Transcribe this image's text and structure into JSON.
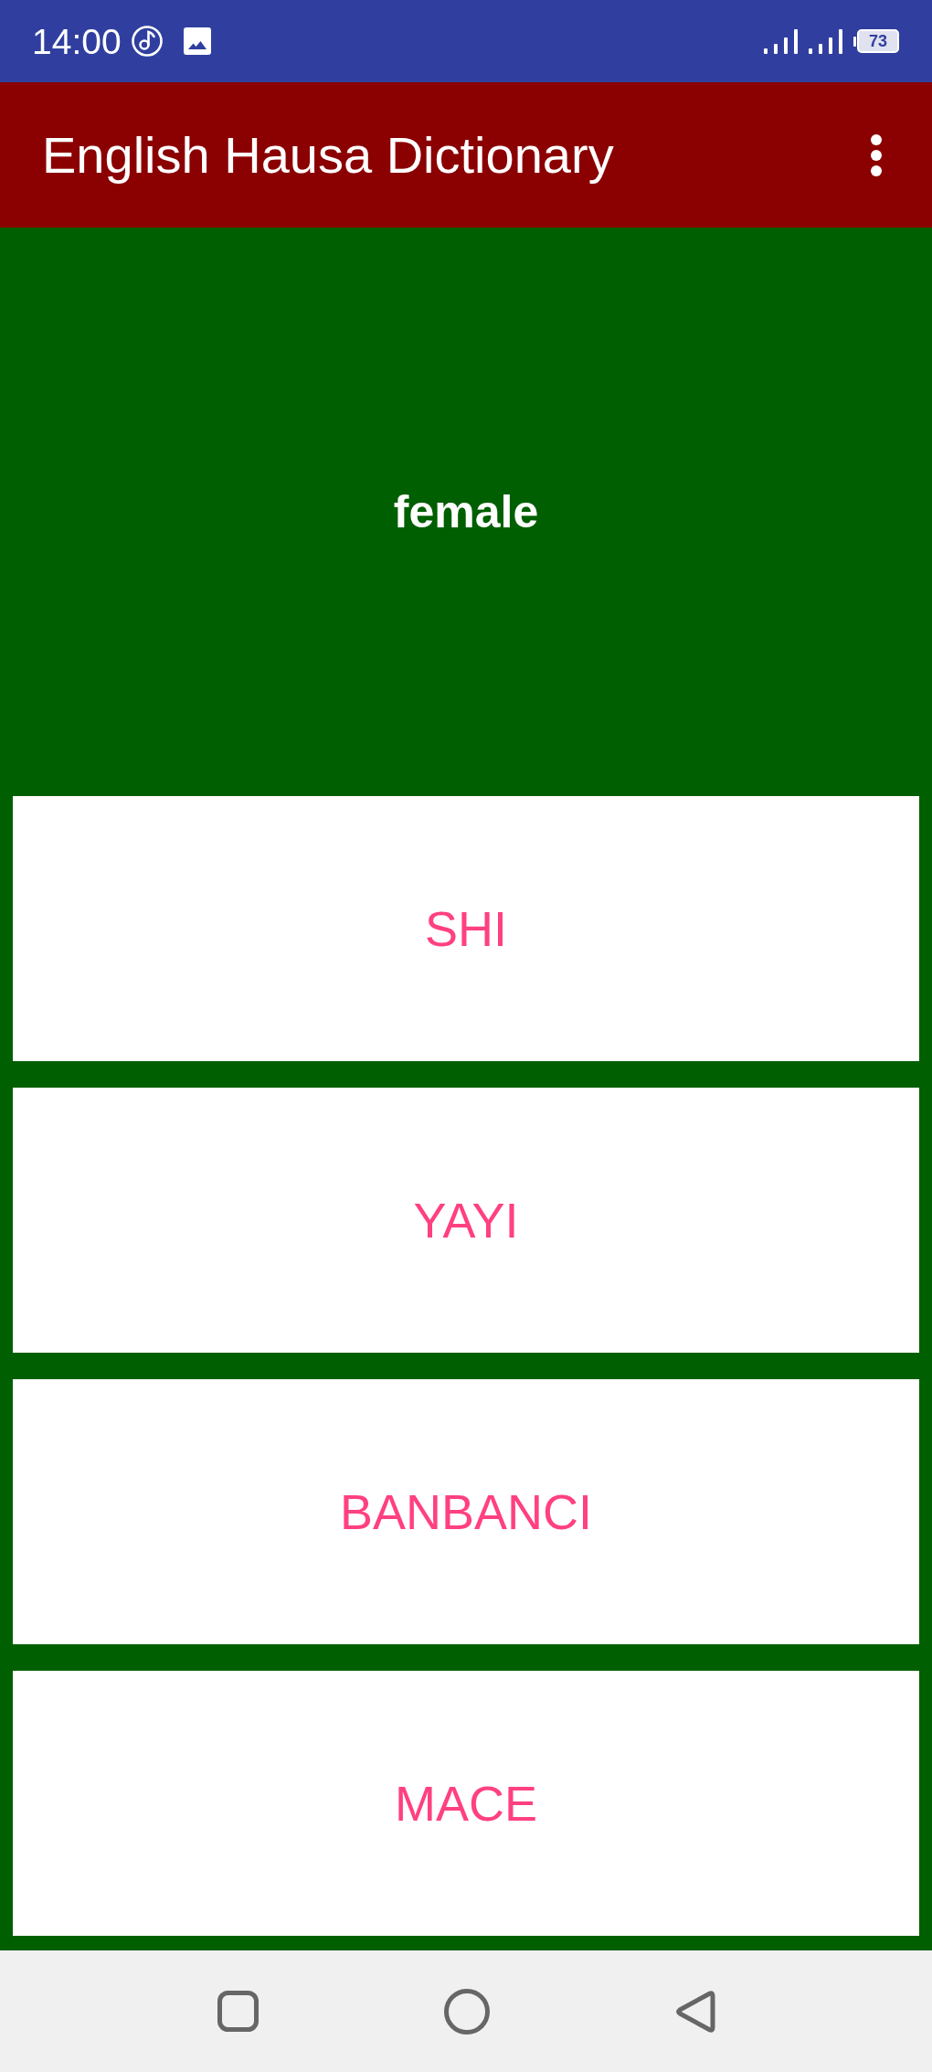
{
  "status_bar": {
    "time": "14:00",
    "battery": "73"
  },
  "app_bar": {
    "title": "English Hausa Dictionary"
  },
  "word": {
    "text": "female"
  },
  "options": [
    {
      "text": "SHI"
    },
    {
      "text": "YAYI"
    },
    {
      "text": "BANBANCI"
    },
    {
      "text": "MACE"
    }
  ]
}
